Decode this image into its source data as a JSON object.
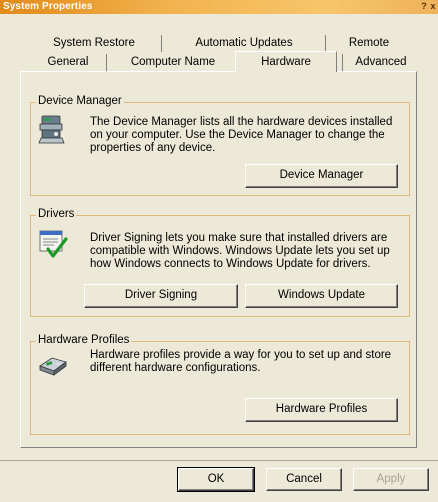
{
  "window": {
    "title": "System Properties",
    "help_button": "?",
    "close_button": "x"
  },
  "tabs": {
    "row1": [
      "System Restore",
      "Automatic Updates",
      "Remote"
    ],
    "row2": [
      "General",
      "Computer Name",
      "Hardware",
      "Advanced"
    ],
    "active": "Hardware"
  },
  "device_manager": {
    "group_label": "Device Manager",
    "description_lines": [
      "The Device Manager lists all the hardware devices installed",
      "on your computer. Use the Device Manager to change the",
      "properties of any device."
    ],
    "button": "Device Manager",
    "icon": "device-manager-icon"
  },
  "drivers": {
    "group_label": "Drivers",
    "description_lines": [
      "Driver Signing lets you make sure that installed drivers are",
      "compatible with Windows. Windows Update lets you set up",
      "how Windows connects to Windows Update for drivers."
    ],
    "signing_button": "Driver Signing",
    "update_button": "Windows Update",
    "icon": "driver-signing-icon"
  },
  "hardware_profiles": {
    "group_label": "Hardware Profiles",
    "description_lines": [
      "Hardware profiles provide a way for you to set up and store",
      "different hardware configurations."
    ],
    "button": "Hardware Profiles",
    "icon": "hardware-profiles-icon"
  },
  "dialog_buttons": {
    "ok": "OK",
    "cancel": "Cancel",
    "apply": "Apply"
  },
  "colors": {
    "title_gradient_start": "#e28a1a",
    "title_gradient_end": "#f7c56a",
    "dialog_background": "#ece9d8",
    "group_border": "#e0b87a",
    "disabled_text": "#a9a593"
  }
}
